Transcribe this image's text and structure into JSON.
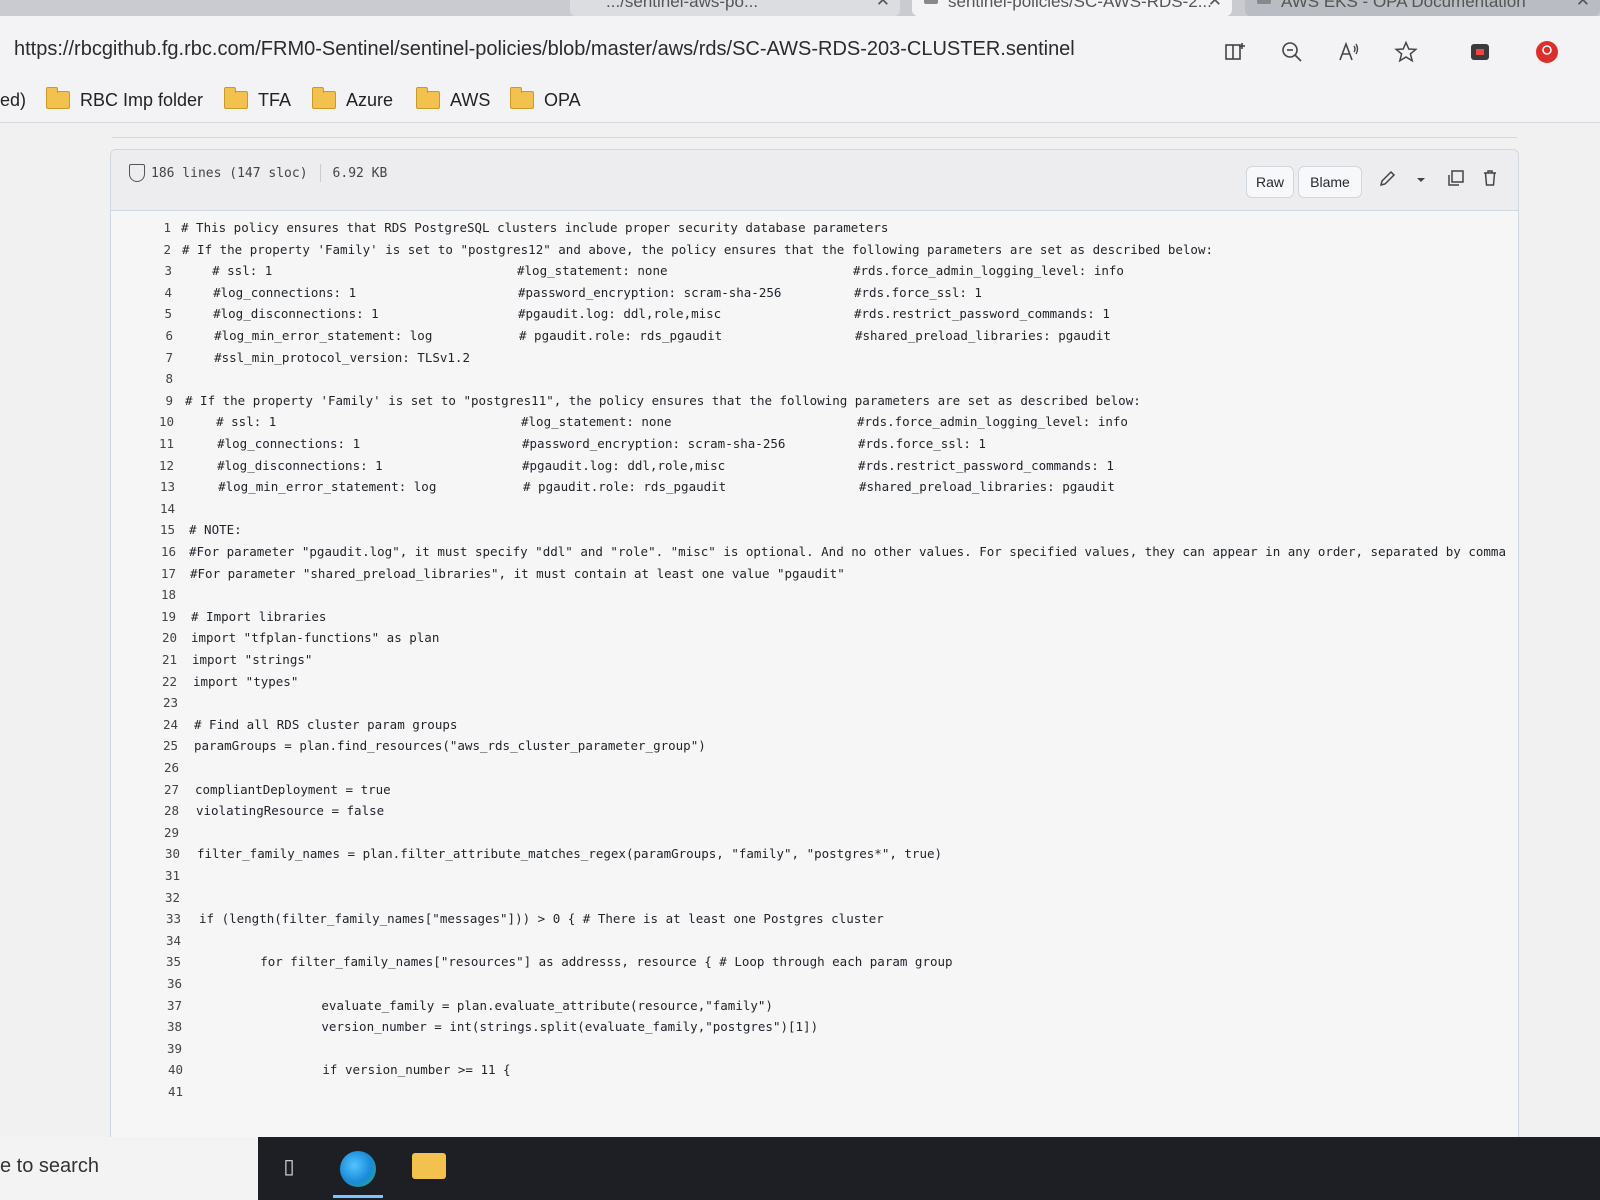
{
  "tabs": [
    {
      "label": ".../sentinel-aws-po...",
      "close": "✕"
    },
    {
      "label": "sentinel-policies/SC-AWS-RDS-2...",
      "close": "✕"
    },
    {
      "label": "AWS EKS - OPA Documentation",
      "close": "✕"
    }
  ],
  "address_bar": {
    "url": "https://rbcgithub.fg.rbc.com/FRM0-Sentinel/sentinel-policies/blob/master/aws/rds/SC-AWS-RDS-203-CLUSTER.sentinel",
    "icons": [
      "split-screen-icon",
      "zoom-out-icon",
      "read-aloud-icon",
      "favorite-star-icon",
      "extension-icon",
      "profile-icon"
    ]
  },
  "bookmarks": {
    "overflow_label": "ed)",
    "items": [
      {
        "label": "RBC Imp folder"
      },
      {
        "label": "TFA"
      },
      {
        "label": "Azure"
      },
      {
        "label": "AWS"
      },
      {
        "label": "OPA"
      }
    ]
  },
  "file": {
    "lines_info": "186 lines (147 sloc)",
    "size": "6.92 KB",
    "raw_label": "Raw",
    "blame_label": "Blame"
  },
  "code_lines": [
    {
      "n": "1",
      "a": "# This policy ensures that RDS PostgreSQL clusters include proper security database parameters",
      "b": "",
      "c": ""
    },
    {
      "n": "2",
      "a": "# If the property 'Family' is set to \"postgres12\" and above, the policy ensures that the following parameters are set as described below:",
      "b": "",
      "c": ""
    },
    {
      "n": "3",
      "a": "    # ssl: 1",
      "b": "#log_statement: none",
      "c": "#rds.force_admin_logging_level: info"
    },
    {
      "n": "4",
      "a": "    #log_connections: 1",
      "b": "#password_encryption: scram-sha-256",
      "c": "#rds.force_ssl: 1"
    },
    {
      "n": "5",
      "a": "    #log_disconnections: 1",
      "b": "#pgaudit.log: ddl,role,misc",
      "c": "#rds.restrict_password_commands: 1"
    },
    {
      "n": "6",
      "a": "    #log_min_error_statement: log",
      "b": "# pgaudit.role: rds_pgaudit",
      "c": "#shared_preload_libraries: pgaudit"
    },
    {
      "n": "7",
      "a": "    #ssl_min_protocol_version: TLSv1.2",
      "b": "",
      "c": ""
    },
    {
      "n": "8",
      "a": "",
      "b": "",
      "c": ""
    },
    {
      "n": "9",
      "a": "# If the property 'Family' is set to \"postgres11\", the policy ensures that the following parameters are set as described below:",
      "b": "",
      "c": ""
    },
    {
      "n": "10",
      "a": "    # ssl: 1",
      "b": "#log_statement: none",
      "c": "#rds.force_admin_logging_level: info"
    },
    {
      "n": "11",
      "a": "    #log_connections: 1",
      "b": "#password_encryption: scram-sha-256",
      "c": "#rds.force_ssl: 1"
    },
    {
      "n": "12",
      "a": "    #log_disconnections: 1",
      "b": "#pgaudit.log: ddl,role,misc",
      "c": "#rds.restrict_password_commands: 1"
    },
    {
      "n": "13",
      "a": "    #log_min_error_statement: log",
      "b": "# pgaudit.role: rds_pgaudit",
      "c": "#shared_preload_libraries: pgaudit"
    },
    {
      "n": "14",
      "a": "",
      "b": "",
      "c": ""
    },
    {
      "n": "15",
      "a": "# NOTE:",
      "b": "",
      "c": ""
    },
    {
      "n": "16",
      "a": "#For parameter \"pgaudit.log\", it must specify \"ddl\" and \"role\". \"misc\" is optional. And no other values. For specified values, they can appear in any order, separated by comma",
      "b": "",
      "c": ""
    },
    {
      "n": "17",
      "a": "#For parameter \"shared_preload_libraries\", it must contain at least one value \"pgaudit\"",
      "b": "",
      "c": ""
    },
    {
      "n": "18",
      "a": "",
      "b": "",
      "c": ""
    },
    {
      "n": "19",
      "a": "# Import libraries",
      "b": "",
      "c": ""
    },
    {
      "n": "20",
      "a": "import \"tfplan-functions\" as plan",
      "b": "",
      "c": ""
    },
    {
      "n": "21",
      "a": "import \"strings\"",
      "b": "",
      "c": ""
    },
    {
      "n": "22",
      "a": "import \"types\"",
      "b": "",
      "c": ""
    },
    {
      "n": "23",
      "a": "",
      "b": "",
      "c": ""
    },
    {
      "n": "24",
      "a": "# Find all RDS cluster param groups",
      "b": "",
      "c": ""
    },
    {
      "n": "25",
      "a": "paramGroups = plan.find_resources(\"aws_rds_cluster_parameter_group\")",
      "b": "",
      "c": ""
    },
    {
      "n": "26",
      "a": "",
      "b": "",
      "c": ""
    },
    {
      "n": "27",
      "a": "compliantDeployment = true",
      "b": "",
      "c": ""
    },
    {
      "n": "28",
      "a": "violatingResource = false",
      "b": "",
      "c": ""
    },
    {
      "n": "29",
      "a": "",
      "b": "",
      "c": ""
    },
    {
      "n": "30",
      "a": "filter_family_names = plan.filter_attribute_matches_regex(paramGroups, \"family\", \"postgres*\", true)",
      "b": "",
      "c": ""
    },
    {
      "n": "31",
      "a": "",
      "b": "",
      "c": ""
    },
    {
      "n": "32",
      "a": "",
      "b": "",
      "c": ""
    },
    {
      "n": "33",
      "a": "if (length(filter_family_names[\"messages\"])) > 0 { # There is at least one Postgres cluster",
      "b": "",
      "c": ""
    },
    {
      "n": "34",
      "a": "",
      "b": "",
      "c": ""
    },
    {
      "n": "35",
      "a": "        for filter_family_names[\"resources\"] as addresss, resource { # Loop through each param group",
      "b": "",
      "c": ""
    },
    {
      "n": "36",
      "a": "",
      "b": "",
      "c": ""
    },
    {
      "n": "37",
      "a": "                evaluate_family = plan.evaluate_attribute(resource,\"family\")",
      "b": "",
      "c": ""
    },
    {
      "n": "38",
      "a": "                version_number = int(strings.split(evaluate_family,\"postgres\")[1])",
      "b": "",
      "c": ""
    },
    {
      "n": "39",
      "a": "",
      "b": "",
      "c": ""
    },
    {
      "n": "40",
      "a": "                if version_number >= 11 {",
      "b": "",
      "c": ""
    },
    {
      "n": "41",
      "a": "",
      "b": "",
      "c": ""
    }
  ],
  "taskbar": {
    "search_text": "e to search"
  }
}
